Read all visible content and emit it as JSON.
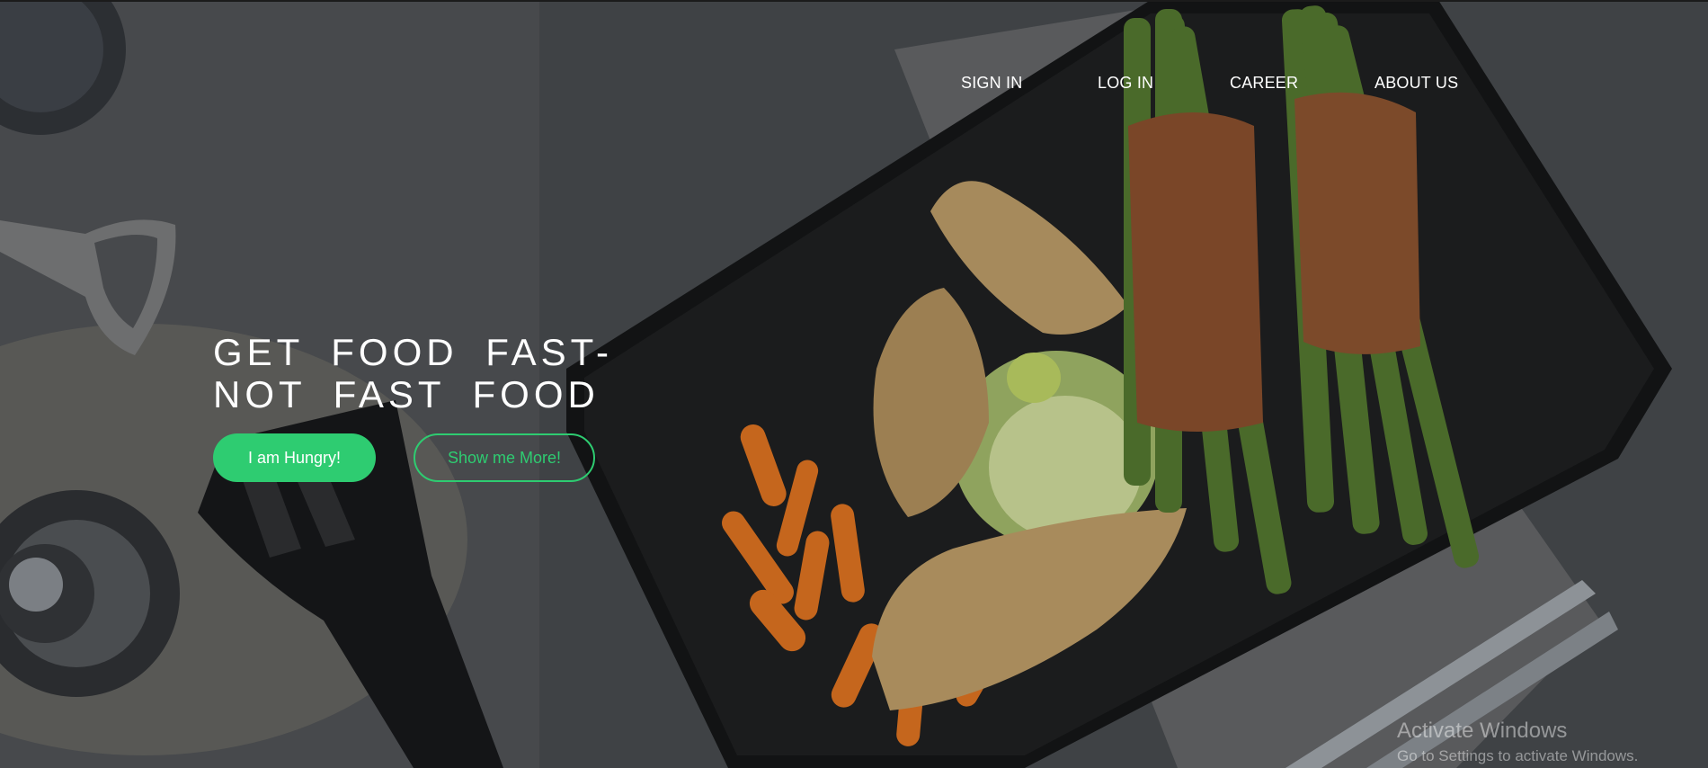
{
  "nav": {
    "items": [
      {
        "label": "SIGN IN"
      },
      {
        "label": "LOG IN"
      },
      {
        "label": "CAREER"
      },
      {
        "label": "ABOUT US"
      }
    ]
  },
  "hero": {
    "headline_line1": "GET FOOD FAST-",
    "headline_line2": "NOT FAST FOOD",
    "primary_button": "I am Hungry!",
    "secondary_button": "Show me More!"
  },
  "watermark": {
    "title": "Activate Windows",
    "subtitle": "Go to Settings to activate Windows."
  },
  "colors": {
    "accent": "#2ecc71",
    "text": "#ffffff"
  }
}
